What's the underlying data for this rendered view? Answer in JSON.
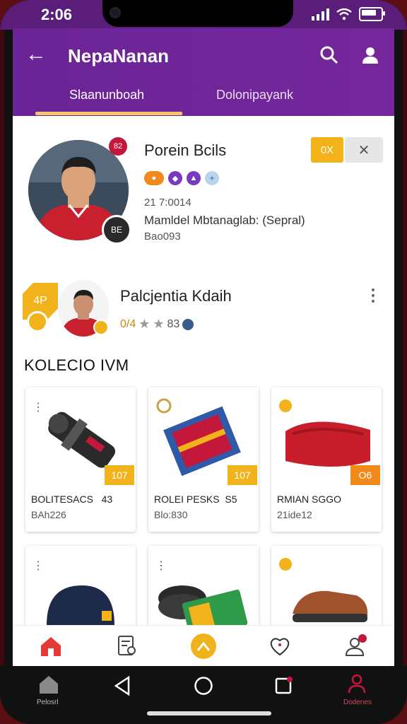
{
  "status": {
    "time": "2:06"
  },
  "appbar": {
    "title": "NepaNanan",
    "tabs": [
      {
        "label": "Slaanunboah"
      },
      {
        "label": "Dolonipayank"
      }
    ]
  },
  "profile": {
    "name": "Porein Bcils",
    "id": "21 7:0014",
    "role": "Mamldel Mbtanaglab: (Sepral)",
    "line3": "Bao093",
    "badge_top": "82",
    "badge_bottom": "BE",
    "follow_label": "0X",
    "close_label": "✕"
  },
  "card2": {
    "name": "Palcjentia Kdaih",
    "meta": "0/4",
    "tag": "4P",
    "extra": "83"
  },
  "section": {
    "title": "KOLECIO IVM"
  },
  "items": [
    {
      "name": "BOLITESACS",
      "count": "43",
      "sub": "BAh226",
      "price": "107"
    },
    {
      "name": "ROLEI PESKS",
      "count": "S5",
      "sub": "Blo:830",
      "price": "107"
    },
    {
      "name": "RMIAN SGGO",
      "count": "",
      "sub": "21ide12",
      "price": "O6"
    }
  ],
  "sysnav": {
    "left_label": "Pelosrl",
    "right_label": "Dodenes"
  },
  "colors": {
    "primary": "#6a2496",
    "accent": "#f2b21c",
    "red": "#c4173c"
  }
}
